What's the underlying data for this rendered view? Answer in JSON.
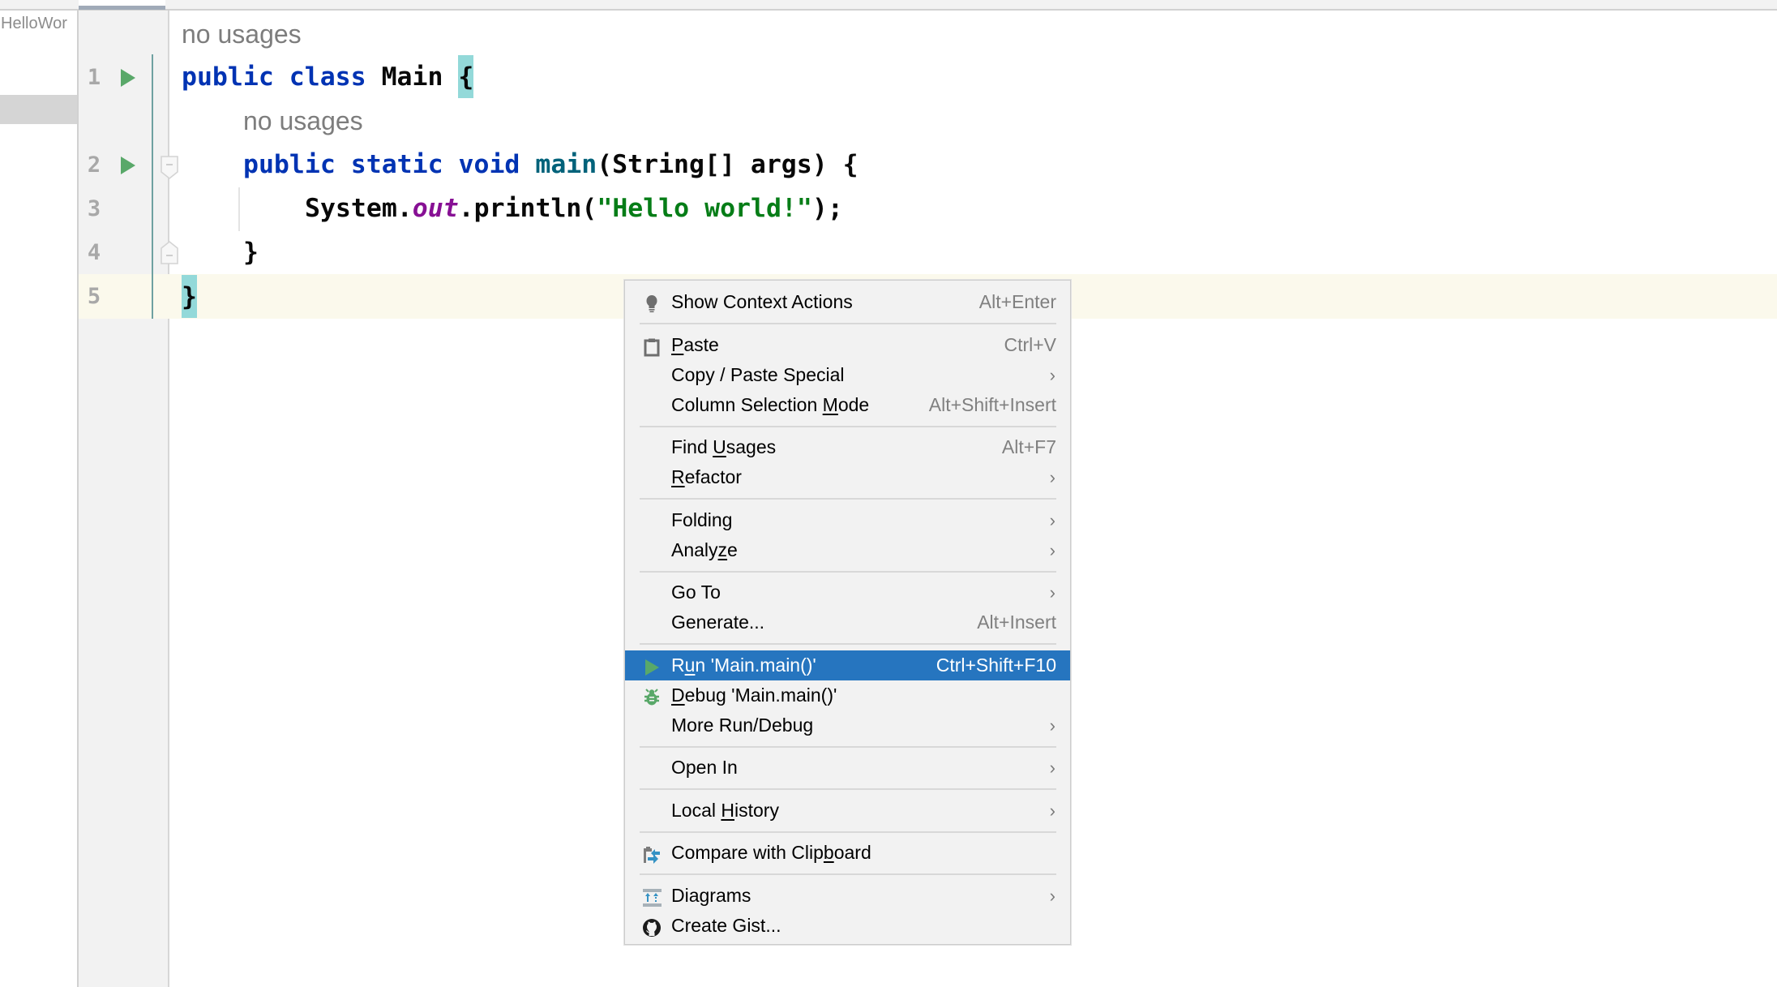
{
  "tab_bar": {
    "active_tab_label": ""
  },
  "project_panel": {
    "node_label": "HelloWor"
  },
  "gutter": {
    "line_numbers": [
      "1",
      "2",
      "3",
      "4",
      "5"
    ]
  },
  "editor": {
    "hint_class": "no usages",
    "hint_method": "no usages",
    "lines": [
      {
        "keyword1": "public",
        "keyword2": "class",
        "name": "Main",
        "brace": "{"
      },
      {
        "keyword1": "public",
        "keyword2": "static",
        "keyword3": "void",
        "method": "main",
        "params": "(String[] args) {"
      },
      {
        "receiver": "System.",
        "field": "out",
        "call": ".println(",
        "string": "\"Hello world!\"",
        "end": ");"
      },
      {
        "text": "}"
      },
      {
        "brace": "}"
      }
    ]
  },
  "context_menu": {
    "items": [
      {
        "label": "Show Context Actions",
        "shortcut": "Alt+Enter",
        "icon": "lightbulb-icon"
      },
      {
        "label_pre": "",
        "mnemonic": "P",
        "label_post": "aste",
        "shortcut": "Ctrl+V",
        "icon": "clipboard-icon"
      },
      {
        "label": "Copy / Paste Special",
        "submenu": ">"
      },
      {
        "label_pre": "Column Selection ",
        "mnemonic": "M",
        "label_post": "ode",
        "shortcut": "Alt+Shift+Insert"
      },
      {
        "label_pre": "Find ",
        "mnemonic": "U",
        "label_post": "sages",
        "shortcut": "Alt+F7"
      },
      {
        "label_pre": "",
        "mnemonic": "R",
        "label_post": "efactor",
        "submenu": ">"
      },
      {
        "label": "Folding",
        "submenu": ">"
      },
      {
        "label_pre": "Analy",
        "mnemonic": "z",
        "label_post": "e",
        "submenu": ">"
      },
      {
        "label": "Go To",
        "submenu": ">"
      },
      {
        "label": "Generate...",
        "shortcut": "Alt+Insert"
      },
      {
        "label_pre": "R",
        "mnemonic": "u",
        "label_post": "n 'Main.main()'",
        "shortcut": "Ctrl+Shift+F10",
        "icon": "run-icon",
        "selected": true
      },
      {
        "label_pre": "",
        "mnemonic": "D",
        "label_post": "ebug 'Main.main()'",
        "icon": "debug-bug-icon"
      },
      {
        "label": "More Run/Debug",
        "submenu": ">"
      },
      {
        "label": "Open In",
        "submenu": ">"
      },
      {
        "label_pre": "Local ",
        "mnemonic": "H",
        "label_post": "istory",
        "submenu": ">"
      },
      {
        "label_pre": "Compare with Clip",
        "mnemonic": "b",
        "label_post": "oard",
        "icon": "compare-clipboard-icon"
      },
      {
        "label": "Diagrams",
        "submenu": ">",
        "icon": "diagrams-icon"
      },
      {
        "label": "Create Gist...",
        "icon": "github-icon"
      }
    ]
  },
  "colors": {
    "keyword": "#0033b3",
    "method_decl": "#00627a",
    "static_field": "#871094",
    "string": "#067d17",
    "brace_match": "#93d9d9",
    "caret_row": "#fbf9ec",
    "menu_selection": "#2675bf",
    "run_green": "#59a869"
  }
}
